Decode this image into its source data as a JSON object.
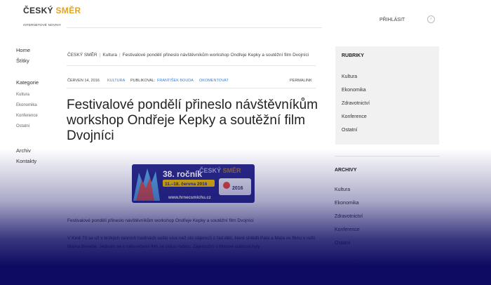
{
  "header": {
    "logo_main": "ČESKÝ ",
    "logo_accent": "SMĚR",
    "tagline": "INTERNETOVÉ NOVINY",
    "login_label": "PŘIHLÁSIT"
  },
  "left_nav": {
    "home": "Home",
    "tags": "Štítky",
    "categories_heading": "Kategorie",
    "categories": [
      "Kultura",
      "Ekonomika",
      "Konference",
      "Ostatní"
    ],
    "archive": "Archiv",
    "contacts": "Kontakty"
  },
  "breadcrumb": {
    "home": "ČESKÝ SMĚR",
    "section": "Kultura",
    "current": "Festivalové pondělí přineslo návštěvníkům workshop Ondřeje Kepky a soutěžní film Dvojníci"
  },
  "article_meta": {
    "date": "ČERVEN 14, 2016",
    "category": "KULTURA",
    "published_by_label": "PUBLIKOVAL:",
    "author": "FRANTIŠEK BOUDA",
    "comment": "OKOMENTOVAT",
    "permalink": "PERMALINK"
  },
  "article": {
    "title": "Festivalové pondělí přineslo návštěvníkům workshop Ondřeje Kepky a soutěžní film Dvojníci",
    "lead": "Festivalové pondělí přineslo návštěvníkům workshop Ondřeje Kepky a soutěžní film Dvojníci",
    "body": "V Kině 70 se už v brzkých ranních hodinách sešlo více než sto zájemců z řad dětí, které shlédli Pata a Mata ve filmu v režii Marka Beneše. Jednalo se o celovečerní film se celou rodinu. Zájemcům o filmové události byly"
  },
  "banner": {
    "edition": "38. ročník",
    "dates": "11.–18. června 2016",
    "url": "www.hrnecsmichu.cz",
    "overlay_main": "ČESKÝ ",
    "overlay_accent": "SMĚR",
    "badge_year": "2016",
    "colors": {
      "bg": "#2b2a8a",
      "accent": "#f2c200",
      "text": "#ffffff"
    }
  },
  "sidebar": {
    "rubriky_heading": "RUBRIKY",
    "rubriky": [
      "Kultura",
      "Ekonomika",
      "Zdravotnictví",
      "Konference",
      "Ostatní"
    ],
    "archive_heading": "ARCHIVY",
    "archive_items": [
      "Kultura",
      "Ekonomika",
      "Zdravotnictví",
      "Konference",
      "Ostatní"
    ]
  },
  "colors": {
    "accent": "#e8a417",
    "link": "#3d7ed6",
    "overlay": "#0e0b62"
  }
}
